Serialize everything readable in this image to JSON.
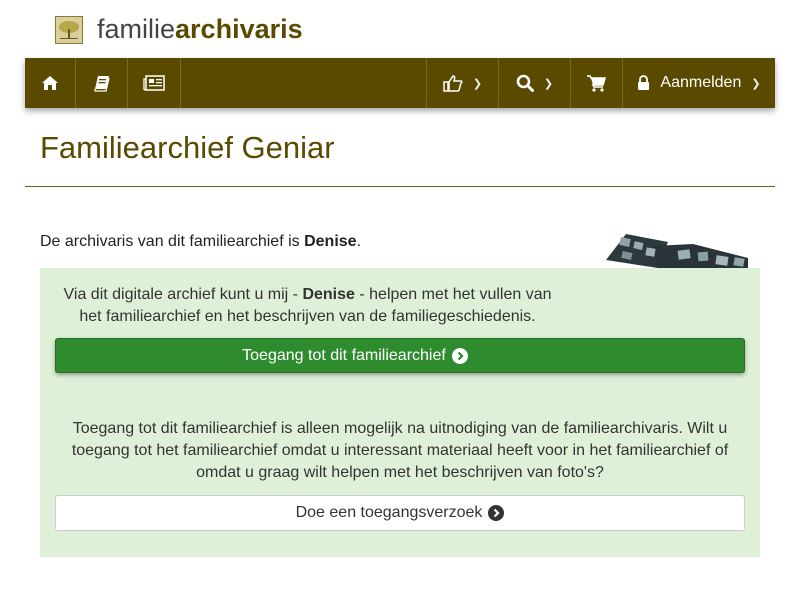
{
  "brand": {
    "light": "familie",
    "bold": "archivaris"
  },
  "nav": {
    "login_label": "Aanmelden"
  },
  "page": {
    "title": "Familiearchief Geniar"
  },
  "intro": {
    "prefix": "De archivaris van dit familiearchief is ",
    "name": "Denise",
    "suffix": "."
  },
  "panel": {
    "text1_prefix": "Via dit digitale archief kunt u mij - ",
    "text1_name": "Denise",
    "text1_suffix": " - helpen met het vullen van het familiearchief en het beschrijven van de familiegeschiedenis.",
    "access_button": "Toegang tot dit familiearchief",
    "text2": "Toegang tot dit familiearchief is alleen mogelijk na uitnodiging van de familiearchivaris. Wilt u toegang tot het familiearchief omdat u interessant materiaal heeft voor in het familiearchief of omdat u graag wilt helpen met het beschrijven van foto's?",
    "request_button": "Doe een toegangsverzoek"
  },
  "colors": {
    "brand": "#5a4a00",
    "panel_bg": "#dff0d8",
    "button_green": "#2e8b2e"
  },
  "icons": [
    "home-icon",
    "book-icon",
    "newspaper-icon",
    "thumbs-up-icon",
    "search-icon",
    "cart-icon",
    "lock-icon",
    "chevron-circle-right-icon"
  ]
}
